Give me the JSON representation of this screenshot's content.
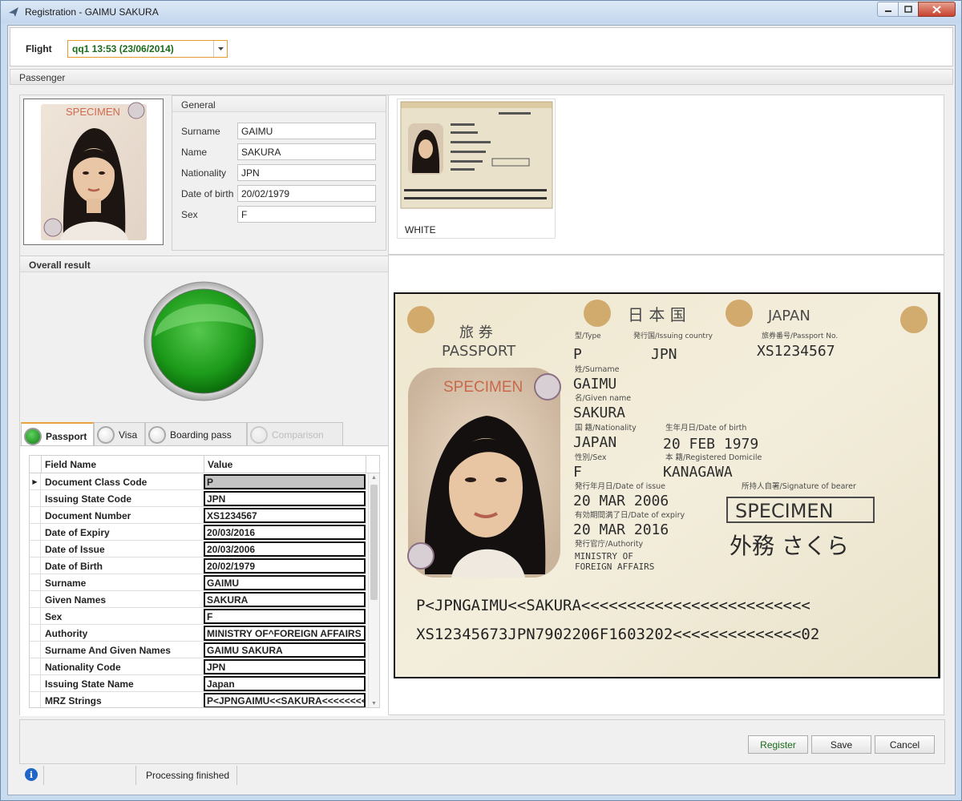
{
  "window": {
    "title": "Registration - GAIMU SAKURA"
  },
  "flight": {
    "label": "Flight",
    "value": "qq1 13:53 (23/06/2014)"
  },
  "passenger": {
    "header": "Passenger"
  },
  "photo": {
    "stamp": "SPECIMEN"
  },
  "general": {
    "header": "General",
    "fields": [
      {
        "label": "Surname",
        "value": "GAIMU"
      },
      {
        "label": "Name",
        "value": "SAKURA"
      },
      {
        "label": "Nationality",
        "value": "JPN"
      },
      {
        "label": "Date of birth",
        "value": "20/02/1979"
      },
      {
        "label": "Sex",
        "value": "F"
      }
    ]
  },
  "overall": {
    "header": "Overall result",
    "status_color": "#22a822"
  },
  "tabs": [
    {
      "label": "Passport",
      "active": true
    },
    {
      "label": "Visa"
    },
    {
      "label": "Boarding pass"
    },
    {
      "label": "Comparison",
      "disabled": true
    }
  ],
  "grid": {
    "columns": [
      "Field Name",
      "Value"
    ],
    "rows": [
      {
        "field": "Document Class Code",
        "value": "P"
      },
      {
        "field": "Issuing State Code",
        "value": "JPN"
      },
      {
        "field": "Document Number",
        "value": "XS1234567"
      },
      {
        "field": "Date of Expiry",
        "value": "20/03/2016"
      },
      {
        "field": "Date of Issue",
        "value": "20/03/2006"
      },
      {
        "field": "Date of Birth",
        "value": "20/02/1979"
      },
      {
        "field": "Surname",
        "value": "GAIMU"
      },
      {
        "field": "Given Names",
        "value": "SAKURA"
      },
      {
        "field": "Sex",
        "value": "F"
      },
      {
        "field": "Authority",
        "value": "MINISTRY OF^FOREIGN AFFAIRS"
      },
      {
        "field": "Surname And Given Names",
        "value": "GAIMU SAKURA"
      },
      {
        "field": "Nationality Code",
        "value": "JPN"
      },
      {
        "field": "Issuing State Name",
        "value": "Japan"
      },
      {
        "field": "MRZ Strings",
        "value": "P<JPNGAIMU<<SAKURA<<<<<<<<<"
      }
    ]
  },
  "thumbnail": {
    "label": "WHITE"
  },
  "passport_scan": {
    "country_jp": "日 本 国",
    "country": "JAPAN",
    "kind_jp": "旅 券",
    "kind": "PASSPORT",
    "type_label": "型/Type",
    "issuing_label": "発行国/Issuing country",
    "passport_no_label": "旅券番号/Passport No.",
    "type": "P",
    "issuing": "JPN",
    "number": "XS1234567",
    "surname_label": "姓/Surname",
    "surname": "GAIMU",
    "given_label": "名/Given name",
    "given": "SAKURA",
    "nationality_label": "国 籍/Nationality",
    "nationality": "JAPAN",
    "dob_label": "生年月日/Date of birth",
    "dob": "20 FEB 1979",
    "sex_label": "性別/Sex",
    "sex": "F",
    "domicile_label": "本 籍/Registered Domicile",
    "domicile": "KANAGAWA",
    "issue_label": "発行年月日/Date of issue",
    "issue": "20 MAR 2006",
    "signature_label": "所持人自署/Signature of bearer",
    "specimen": "SPECIMEN",
    "expiry_label": "有効期間満了日/Date of expiry",
    "expiry": "20 MAR 2016",
    "authority_label": "発行官庁/Authority",
    "authority_1": "MINISTRY OF",
    "authority_2": "FOREIGN AFFAIRS",
    "signature": "外務 さくら",
    "photo_stamp": "SPECIMEN",
    "mrz1": "P<JPNGAIMU<<SAKURA<<<<<<<<<<<<<<<<<<<<<<<<<",
    "mrz2": "XS12345673JPN7902206F1603202<<<<<<<<<<<<<<02"
  },
  "buttons": {
    "register": "Register",
    "save": "Save",
    "cancel": "Cancel"
  },
  "status": {
    "text": "Processing finished",
    "info_icon": "i"
  }
}
